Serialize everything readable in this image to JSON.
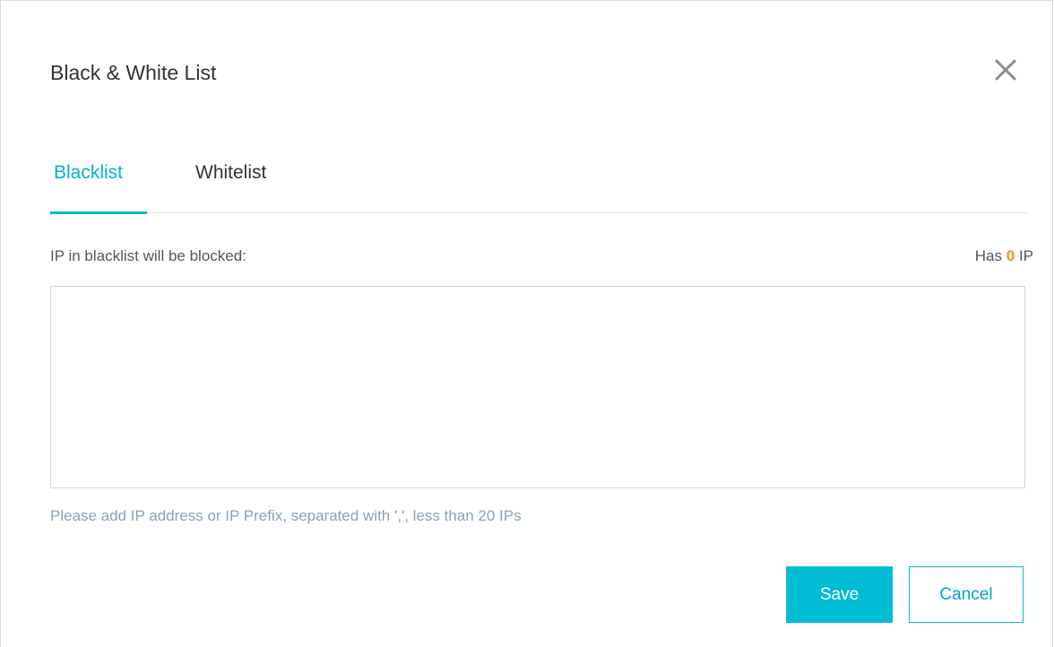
{
  "dialog": {
    "title": "Black & White List",
    "close_icon": "close-icon"
  },
  "tabs": [
    {
      "label": "Blacklist",
      "active": true
    },
    {
      "label": "Whitelist",
      "active": false
    }
  ],
  "blacklist": {
    "label": "IP in blacklist will be blocked:",
    "count_prefix": "Has",
    "count_value": "0",
    "count_suffix": "IP",
    "textarea_value": "",
    "hint": "Please add IP address or IP Prefix, separated with ',', less than 20 IPs"
  },
  "buttons": {
    "save_label": "Save",
    "cancel_label": "Cancel"
  },
  "colors": {
    "accent": "#00bcd4",
    "count_highlight": "#ff8c1a",
    "hint": "#8aa3b1"
  }
}
